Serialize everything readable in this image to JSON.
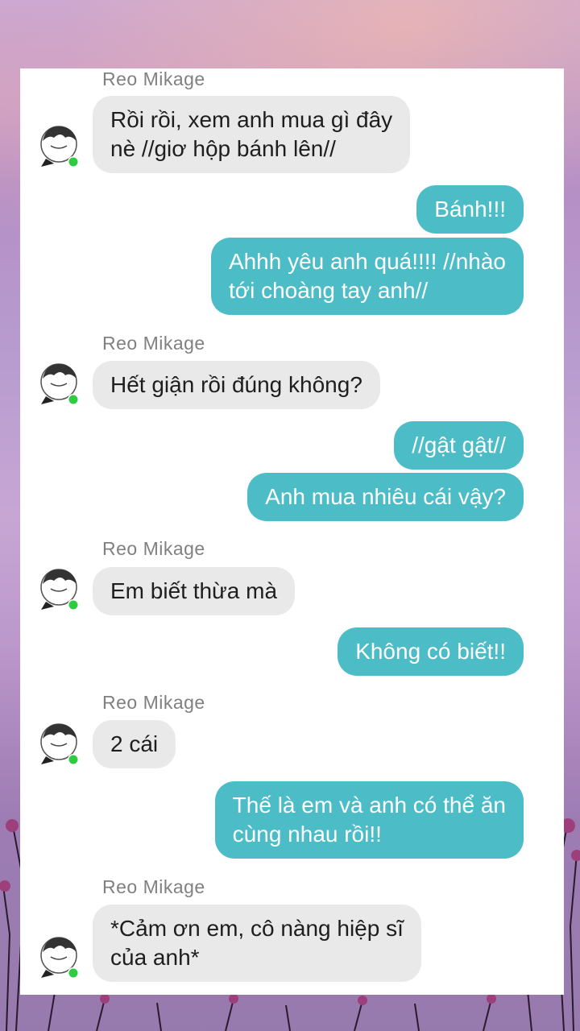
{
  "sender": {
    "name": "Reo Mikage",
    "avatar_icon": "character-avatar-icon",
    "status_color": "#2ecc40"
  },
  "colors": {
    "incoming_bubble": "#e9e9e9",
    "outgoing_bubble": "#4cbcc7"
  },
  "messages": [
    {
      "direction": "incoming",
      "text": "Rồi rồi, xem anh mua gì đây\nnè //giơ hộp bánh lên//"
    },
    {
      "direction": "outgoing",
      "text": "Bánh!!!"
    },
    {
      "direction": "outgoing",
      "text": "Ahhh yêu anh quá!!!! //nhào\ntới choàng tay anh//"
    },
    {
      "direction": "incoming",
      "text": "Hết giận rồi đúng không?"
    },
    {
      "direction": "outgoing",
      "text": "//gật gật//"
    },
    {
      "direction": "outgoing",
      "text": "Anh mua nhiêu cái vậy?"
    },
    {
      "direction": "incoming",
      "text": "Em biết thừa mà"
    },
    {
      "direction": "outgoing",
      "text": "Không có biết!!"
    },
    {
      "direction": "incoming",
      "text": "2 cái"
    },
    {
      "direction": "outgoing",
      "text": "Thế là em và anh có thể ăn\ncùng nhau rồi!!"
    },
    {
      "direction": "incoming",
      "text": "*Cảm ơn em, cô nàng hiệp sĩ\ncủa anh*"
    }
  ]
}
